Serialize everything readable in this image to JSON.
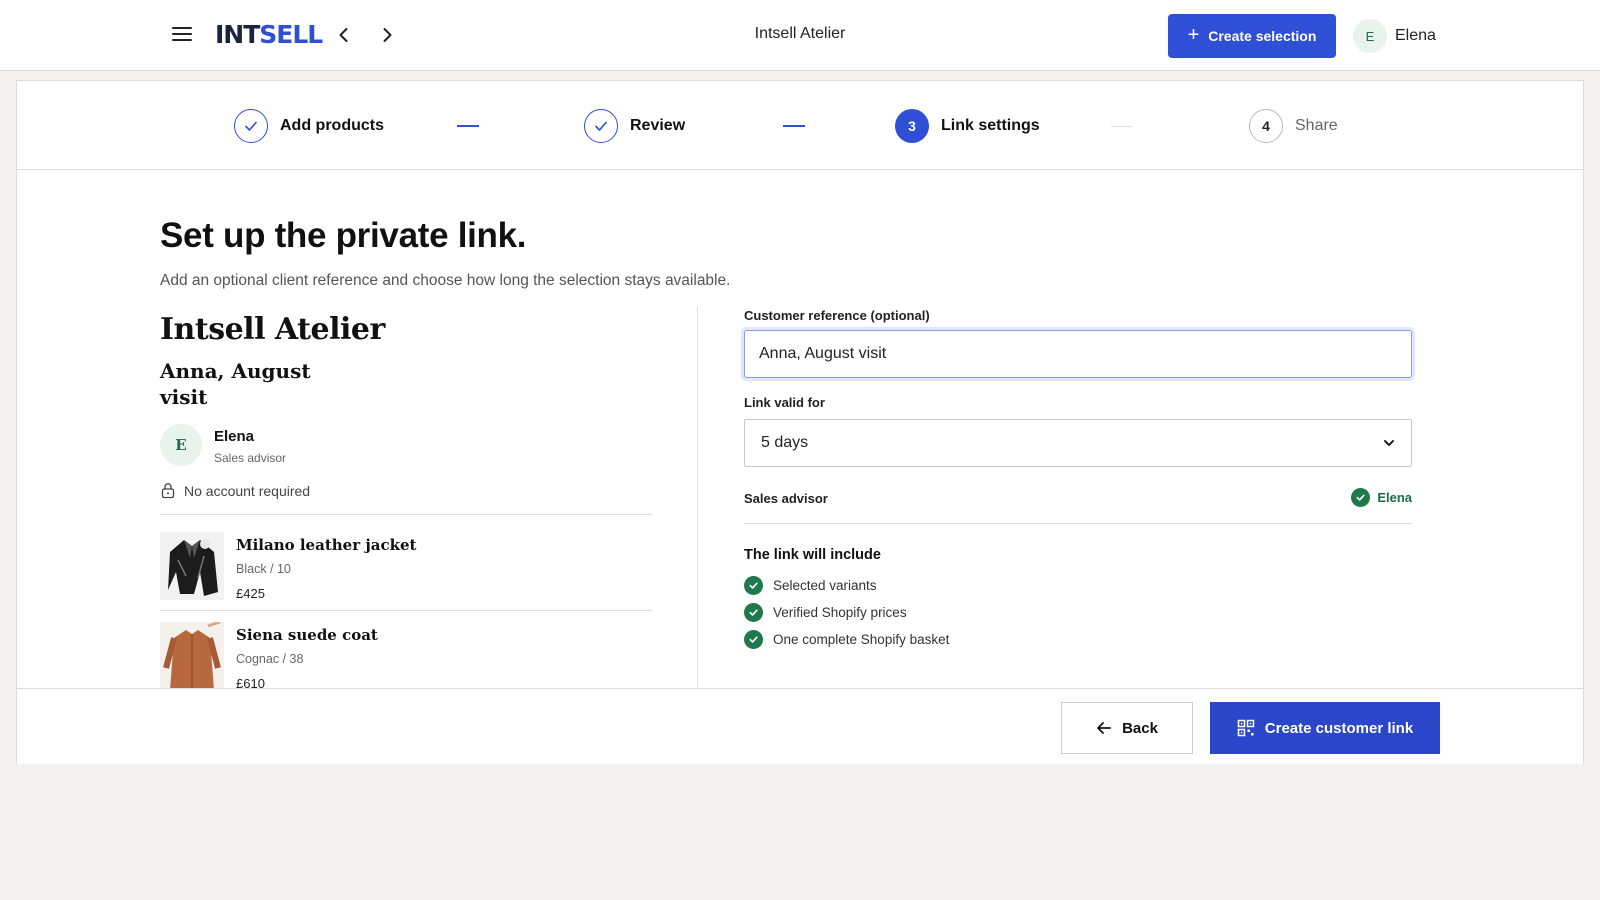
{
  "topbar": {
    "logo_part1": "INT",
    "logo_part2": "SELL",
    "app_title": "Intsell Atelier",
    "create_button": "Create selection",
    "user_initial": "E",
    "user_name": "Elena"
  },
  "stepper": {
    "steps": [
      {
        "label": "Add products",
        "state": "done"
      },
      {
        "label": "Review",
        "state": "done"
      },
      {
        "label": "Link settings",
        "state": "active",
        "number": "3"
      },
      {
        "label": "Share",
        "state": "todo",
        "number": "4"
      }
    ]
  },
  "main": {
    "title": "Set up the private link.",
    "subtitle": "Add an optional client reference and choose how long the selection stays available."
  },
  "preview": {
    "shop_name": "Intsell Atelier",
    "client_reference": "Anna, August visit",
    "advisor_initial": "E",
    "advisor_name": "Elena",
    "advisor_role": "Sales advisor",
    "account_note": "No account required",
    "products": [
      {
        "name": "Milano leather jacket",
        "variant": "Black / 10",
        "price": "£425"
      },
      {
        "name": "Siena suede coat",
        "variant": "Cognac / 38",
        "price": "£610"
      }
    ]
  },
  "form": {
    "reference_label": "Customer reference (optional)",
    "reference_value": "Anna, August visit",
    "validity_label": "Link valid for",
    "validity_value": "5 days",
    "advisor_label": "Sales advisor",
    "advisor_value": "Elena",
    "includes_title": "The link will include",
    "includes": [
      "Selected variants",
      "Verified Shopify prices",
      "One complete Shopify basket"
    ]
  },
  "footer": {
    "back_label": "Back",
    "primary_label": "Create customer link"
  },
  "colors": {
    "accent": "#2f4fd6",
    "success": "#1e7a4a"
  }
}
